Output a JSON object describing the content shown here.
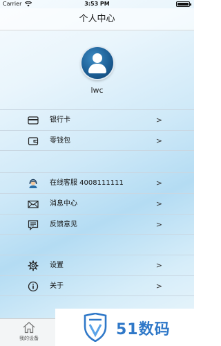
{
  "status_bar": {
    "carrier": "Carrier",
    "time": "3:53 PM"
  },
  "nav": {
    "title": "个人中心"
  },
  "profile": {
    "username": "lwc"
  },
  "group1": [
    {
      "label": "银行卡",
      "icon": "card-icon",
      "chevron": ">"
    },
    {
      "label": "零钱包",
      "icon": "wallet-icon",
      "chevron": ">"
    }
  ],
  "group2": [
    {
      "label": "在线客服 4008111111",
      "icon": "customer-service-icon",
      "chevron": ">"
    },
    {
      "label": "消息中心",
      "icon": "mail-icon",
      "chevron": ">"
    },
    {
      "label": "反馈意见",
      "icon": "feedback-icon",
      "chevron": ">"
    }
  ],
  "group3": [
    {
      "label": "设置",
      "icon": "gear-icon",
      "chevron": ">"
    },
    {
      "label": "关于",
      "icon": "info-icon",
      "chevron": ">"
    }
  ],
  "tab_bar": {
    "items": [
      {
        "label": "我的设备",
        "icon": "home-icon"
      }
    ]
  },
  "watermark": {
    "text": "51数码"
  },
  "colors": {
    "accent": "#1d5f96",
    "watermark": "#2f78c8"
  }
}
